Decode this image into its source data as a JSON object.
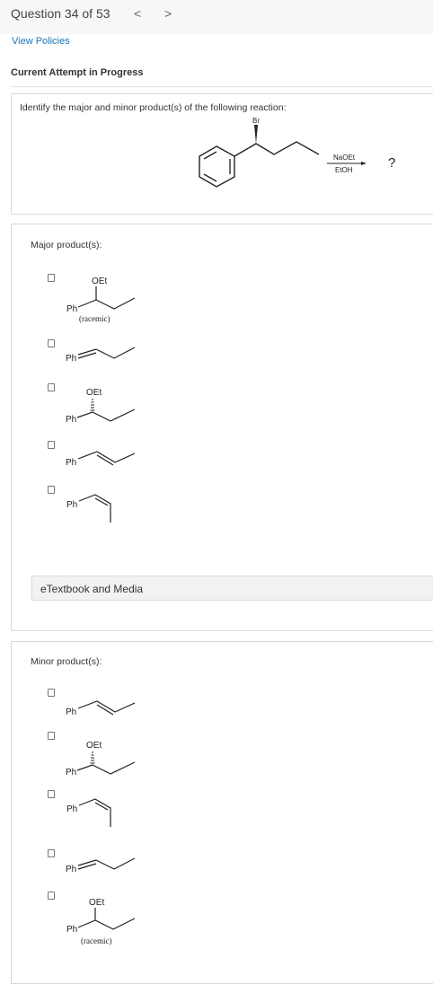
{
  "header": {
    "question_label": "Question 34 of 53",
    "prev_arrow": "<",
    "next_arrow": ">"
  },
  "links": {
    "view_policies": "View Policies"
  },
  "attempt": {
    "status": "Current Attempt in Progress"
  },
  "question": {
    "prompt": "Identify the major and minor product(s) of the following reaction:",
    "reaction": {
      "leaving_group": "Br",
      "reagent": "NaOEt",
      "solvent": "EtOH",
      "product_unknown": "?"
    }
  },
  "major": {
    "label": "Major product(s):",
    "options": [
      {
        "ph": "Ph",
        "sub": "OEt",
        "note": "(racemic)"
      },
      {
        "ph": "Ph"
      },
      {
        "ph": "Ph",
        "sub": "OEt"
      },
      {
        "ph": "Ph"
      },
      {
        "ph": "Ph"
      }
    ]
  },
  "etextbook": {
    "label": "eTextbook and Media"
  },
  "minor": {
    "label": "Minor product(s):",
    "options": [
      {
        "ph": "Ph"
      },
      {
        "ph": "Ph",
        "sub": "OEt"
      },
      {
        "ph": "Ph"
      },
      {
        "ph": "Ph"
      },
      {
        "ph": "Ph",
        "sub": "OEt",
        "note": "(racemic)"
      }
    ]
  }
}
